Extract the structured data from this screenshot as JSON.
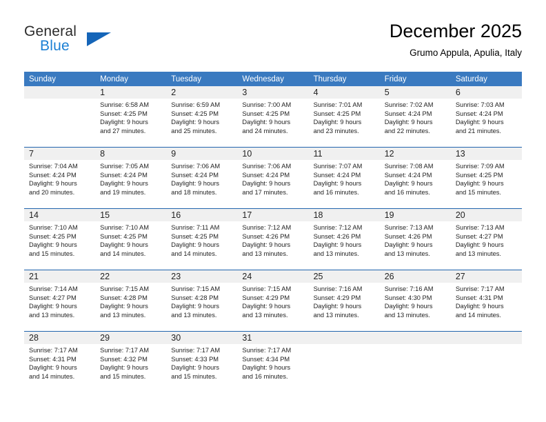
{
  "brand": {
    "name_top": "General",
    "name_bottom": "Blue",
    "accent_color": "#1565b8",
    "text_color": "#2b2b2b",
    "blue_text_color": "#1a7fd4"
  },
  "header": {
    "title": "December 2025",
    "location": "Grumo Appula, Apulia, Italy"
  },
  "theme": {
    "header_row_bg": "#3a7ac0",
    "header_row_text": "#ffffff",
    "row_divider": "#1f63ad",
    "daynum_band_bg": "#f0f0f0",
    "cell_bg": "#ffffff"
  },
  "weekdays": [
    "Sunday",
    "Monday",
    "Tuesday",
    "Wednesday",
    "Thursday",
    "Friday",
    "Saturday"
  ],
  "weeks": [
    [
      {
        "day": "",
        "empty": true
      },
      {
        "day": "1",
        "sunrise": "Sunrise: 6:58 AM",
        "sunset": "Sunset: 4:25 PM",
        "daylight1": "Daylight: 9 hours",
        "daylight2": "and 27 minutes."
      },
      {
        "day": "2",
        "sunrise": "Sunrise: 6:59 AM",
        "sunset": "Sunset: 4:25 PM",
        "daylight1": "Daylight: 9 hours",
        "daylight2": "and 25 minutes."
      },
      {
        "day": "3",
        "sunrise": "Sunrise: 7:00 AM",
        "sunset": "Sunset: 4:25 PM",
        "daylight1": "Daylight: 9 hours",
        "daylight2": "and 24 minutes."
      },
      {
        "day": "4",
        "sunrise": "Sunrise: 7:01 AM",
        "sunset": "Sunset: 4:25 PM",
        "daylight1": "Daylight: 9 hours",
        "daylight2": "and 23 minutes."
      },
      {
        "day": "5",
        "sunrise": "Sunrise: 7:02 AM",
        "sunset": "Sunset: 4:24 PM",
        "daylight1": "Daylight: 9 hours",
        "daylight2": "and 22 minutes."
      },
      {
        "day": "6",
        "sunrise": "Sunrise: 7:03 AM",
        "sunset": "Sunset: 4:24 PM",
        "daylight1": "Daylight: 9 hours",
        "daylight2": "and 21 minutes."
      }
    ],
    [
      {
        "day": "7",
        "sunrise": "Sunrise: 7:04 AM",
        "sunset": "Sunset: 4:24 PM",
        "daylight1": "Daylight: 9 hours",
        "daylight2": "and 20 minutes."
      },
      {
        "day": "8",
        "sunrise": "Sunrise: 7:05 AM",
        "sunset": "Sunset: 4:24 PM",
        "daylight1": "Daylight: 9 hours",
        "daylight2": "and 19 minutes."
      },
      {
        "day": "9",
        "sunrise": "Sunrise: 7:06 AM",
        "sunset": "Sunset: 4:24 PM",
        "daylight1": "Daylight: 9 hours",
        "daylight2": "and 18 minutes."
      },
      {
        "day": "10",
        "sunrise": "Sunrise: 7:06 AM",
        "sunset": "Sunset: 4:24 PM",
        "daylight1": "Daylight: 9 hours",
        "daylight2": "and 17 minutes."
      },
      {
        "day": "11",
        "sunrise": "Sunrise: 7:07 AM",
        "sunset": "Sunset: 4:24 PM",
        "daylight1": "Daylight: 9 hours",
        "daylight2": "and 16 minutes."
      },
      {
        "day": "12",
        "sunrise": "Sunrise: 7:08 AM",
        "sunset": "Sunset: 4:24 PM",
        "daylight1": "Daylight: 9 hours",
        "daylight2": "and 16 minutes."
      },
      {
        "day": "13",
        "sunrise": "Sunrise: 7:09 AM",
        "sunset": "Sunset: 4:25 PM",
        "daylight1": "Daylight: 9 hours",
        "daylight2": "and 15 minutes."
      }
    ],
    [
      {
        "day": "14",
        "sunrise": "Sunrise: 7:10 AM",
        "sunset": "Sunset: 4:25 PM",
        "daylight1": "Daylight: 9 hours",
        "daylight2": "and 15 minutes."
      },
      {
        "day": "15",
        "sunrise": "Sunrise: 7:10 AM",
        "sunset": "Sunset: 4:25 PM",
        "daylight1": "Daylight: 9 hours",
        "daylight2": "and 14 minutes."
      },
      {
        "day": "16",
        "sunrise": "Sunrise: 7:11 AM",
        "sunset": "Sunset: 4:25 PM",
        "daylight1": "Daylight: 9 hours",
        "daylight2": "and 14 minutes."
      },
      {
        "day": "17",
        "sunrise": "Sunrise: 7:12 AM",
        "sunset": "Sunset: 4:26 PM",
        "daylight1": "Daylight: 9 hours",
        "daylight2": "and 13 minutes."
      },
      {
        "day": "18",
        "sunrise": "Sunrise: 7:12 AM",
        "sunset": "Sunset: 4:26 PM",
        "daylight1": "Daylight: 9 hours",
        "daylight2": "and 13 minutes."
      },
      {
        "day": "19",
        "sunrise": "Sunrise: 7:13 AM",
        "sunset": "Sunset: 4:26 PM",
        "daylight1": "Daylight: 9 hours",
        "daylight2": "and 13 minutes."
      },
      {
        "day": "20",
        "sunrise": "Sunrise: 7:13 AM",
        "sunset": "Sunset: 4:27 PM",
        "daylight1": "Daylight: 9 hours",
        "daylight2": "and 13 minutes."
      }
    ],
    [
      {
        "day": "21",
        "sunrise": "Sunrise: 7:14 AM",
        "sunset": "Sunset: 4:27 PM",
        "daylight1": "Daylight: 9 hours",
        "daylight2": "and 13 minutes."
      },
      {
        "day": "22",
        "sunrise": "Sunrise: 7:15 AM",
        "sunset": "Sunset: 4:28 PM",
        "daylight1": "Daylight: 9 hours",
        "daylight2": "and 13 minutes."
      },
      {
        "day": "23",
        "sunrise": "Sunrise: 7:15 AM",
        "sunset": "Sunset: 4:28 PM",
        "daylight1": "Daylight: 9 hours",
        "daylight2": "and 13 minutes."
      },
      {
        "day": "24",
        "sunrise": "Sunrise: 7:15 AM",
        "sunset": "Sunset: 4:29 PM",
        "daylight1": "Daylight: 9 hours",
        "daylight2": "and 13 minutes."
      },
      {
        "day": "25",
        "sunrise": "Sunrise: 7:16 AM",
        "sunset": "Sunset: 4:29 PM",
        "daylight1": "Daylight: 9 hours",
        "daylight2": "and 13 minutes."
      },
      {
        "day": "26",
        "sunrise": "Sunrise: 7:16 AM",
        "sunset": "Sunset: 4:30 PM",
        "daylight1": "Daylight: 9 hours",
        "daylight2": "and 13 minutes."
      },
      {
        "day": "27",
        "sunrise": "Sunrise: 7:17 AM",
        "sunset": "Sunset: 4:31 PM",
        "daylight1": "Daylight: 9 hours",
        "daylight2": "and 14 minutes."
      }
    ],
    [
      {
        "day": "28",
        "sunrise": "Sunrise: 7:17 AM",
        "sunset": "Sunset: 4:31 PM",
        "daylight1": "Daylight: 9 hours",
        "daylight2": "and 14 minutes."
      },
      {
        "day": "29",
        "sunrise": "Sunrise: 7:17 AM",
        "sunset": "Sunset: 4:32 PM",
        "daylight1": "Daylight: 9 hours",
        "daylight2": "and 15 minutes."
      },
      {
        "day": "30",
        "sunrise": "Sunrise: 7:17 AM",
        "sunset": "Sunset: 4:33 PM",
        "daylight1": "Daylight: 9 hours",
        "daylight2": "and 15 minutes."
      },
      {
        "day": "31",
        "sunrise": "Sunrise: 7:17 AM",
        "sunset": "Sunset: 4:34 PM",
        "daylight1": "Daylight: 9 hours",
        "daylight2": "and 16 minutes."
      },
      {
        "day": "",
        "empty": true
      },
      {
        "day": "",
        "empty": true
      },
      {
        "day": "",
        "empty": true
      }
    ]
  ]
}
